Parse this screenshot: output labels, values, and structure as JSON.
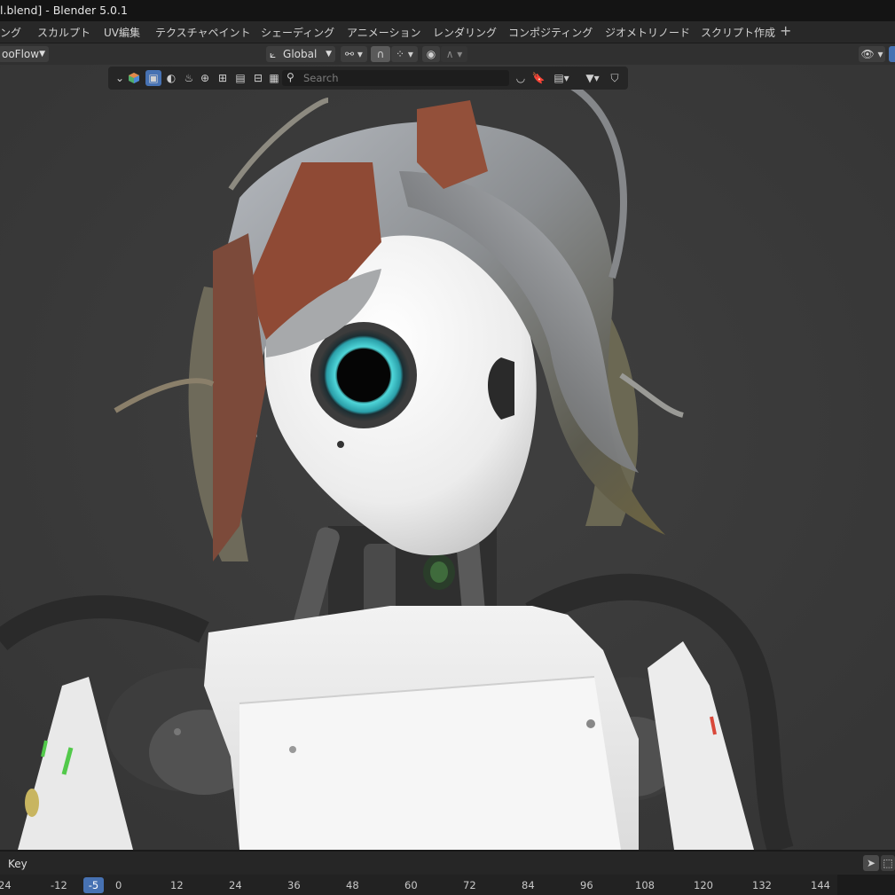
{
  "window": {
    "title": "l.blend] - Blender 5.0.1"
  },
  "workspace_tabs": [
    "ング",
    "スカルプト",
    "UV編集",
    "テクスチャペイント",
    "シェーディング",
    "アニメーション",
    "レンダリング",
    "コンポジティング",
    "ジオメトリノード",
    "スクリプト作成"
  ],
  "workspace_add": "+",
  "header": {
    "mode_label": "ooFlow",
    "orientation": "Global"
  },
  "viewport_toolbar": {
    "search_placeholder": "Search"
  },
  "timeline": {
    "key_label": "Key",
    "current_frame": "-5",
    "ticks": [
      "24",
      "-12",
      "0",
      "12",
      "24",
      "36",
      "48",
      "60",
      "72",
      "84",
      "96",
      "108",
      "120",
      "132",
      "144"
    ]
  },
  "colors": {
    "accent": "#4772b3",
    "viewport_bg": "#3a3a3a",
    "eye_glow": "#4fd6d9"
  }
}
